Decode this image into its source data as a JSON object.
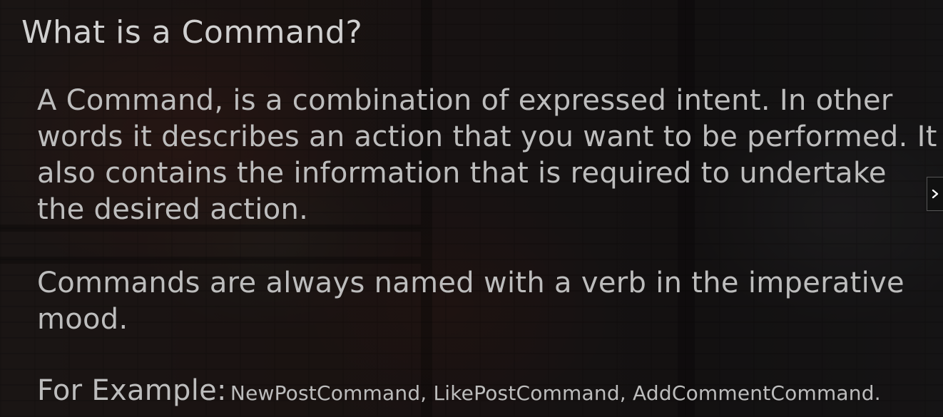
{
  "slide": {
    "title": "What is a Command?",
    "paragraph1": "A Command, is a combination of expressed intent. In other words it describes an action that you want to be performed. It also contains the information that is required to undertake the desired action.",
    "paragraph2": "Commands are always named with a verb in the imperative mood.",
    "example_label": "For Example:",
    "example_list": "NewPostCommand, LikePostCommand, AddCommentCommand."
  },
  "navigation": {
    "next_icon": "chevron-right-icon"
  }
}
